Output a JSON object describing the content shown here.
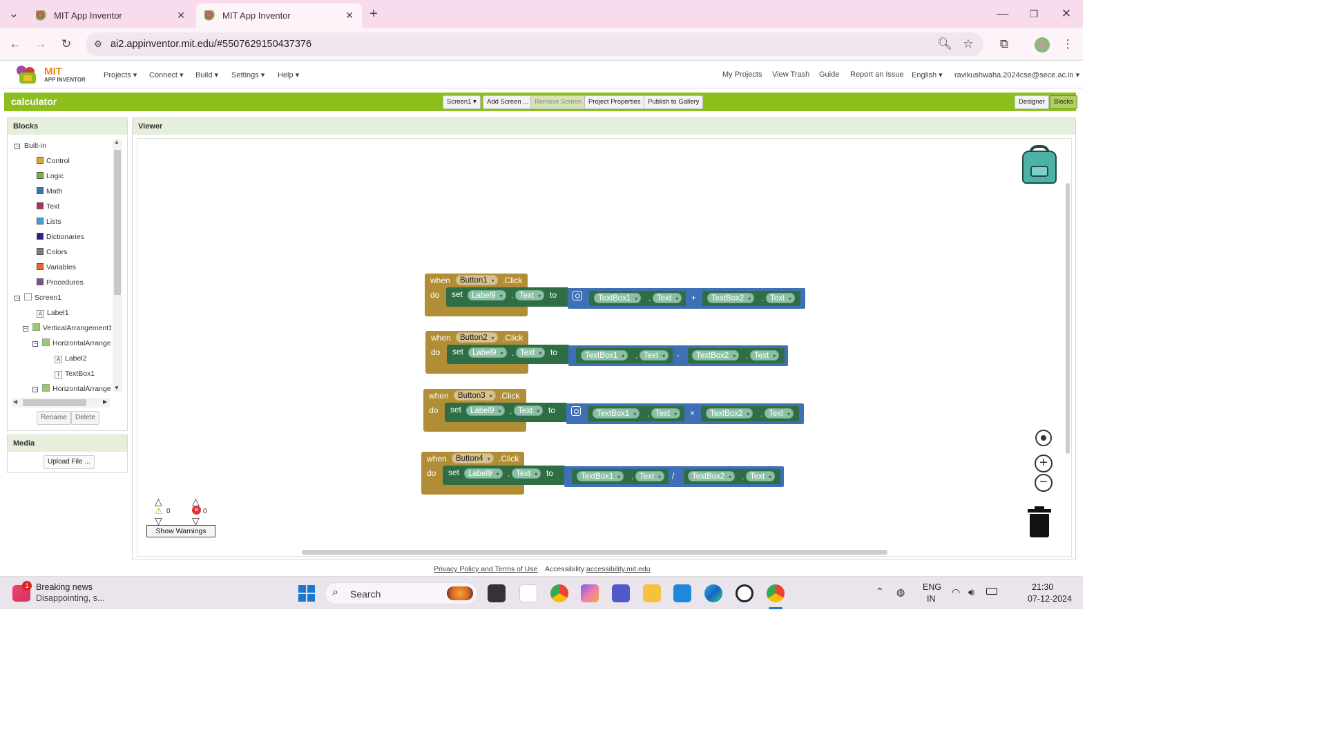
{
  "browser": {
    "tabs": [
      {
        "title": "MIT App Inventor"
      },
      {
        "title": "MIT App Inventor"
      }
    ],
    "url": "ai2.appinventor.mit.edu/#5507629150437376"
  },
  "app": {
    "logo_main": "MIT",
    "logo_sub": "APP INVENTOR",
    "menus": [
      "Projects",
      "Connect",
      "Build",
      "Settings",
      "Help"
    ],
    "right_links": [
      "My Projects",
      "View Trash",
      "Guide",
      "Report an Issue",
      "English"
    ],
    "user": "ravikushwaha.2024cse@sece.ac.in"
  },
  "project": {
    "name": "calculator",
    "screen_select": "Screen1",
    "buttons": [
      "Add Screen ...",
      "Remove Screen",
      "Project Properties",
      "Publish to Gallery"
    ],
    "view_buttons": [
      "Designer",
      "Blocks"
    ]
  },
  "blocks_panel": {
    "title": "Blocks",
    "builtin_label": "Built-in",
    "builtin": [
      {
        "label": "Control",
        "color": "#d9a934"
      },
      {
        "label": "Logic",
        "color": "#77b040"
      },
      {
        "label": "Math",
        "color": "#3f71b5"
      },
      {
        "label": "Text",
        "color": "#b32d5e"
      },
      {
        "label": "Lists",
        "color": "#3fa3d8"
      },
      {
        "label": "Dictionaries",
        "color": "#2d1f91"
      },
      {
        "label": "Colors",
        "color": "#7d7d7d"
      },
      {
        "label": "Variables",
        "color": "#e06c2f"
      },
      {
        "label": "Procedures",
        "color": "#7e4f91"
      }
    ],
    "components": [
      "Screen1",
      "Label1",
      "VerticalArrangement1",
      "HorizontalArrangement",
      "Label2",
      "TextBox1",
      "HorizontalArrangement"
    ],
    "rename": "Rename",
    "delete": "Delete"
  },
  "media_panel": {
    "title": "Media",
    "upload": "Upload File ..."
  },
  "viewer": {
    "title": "Viewer",
    "warnings_count": "0",
    "errors_count": "0",
    "show_warnings": "Show Warnings",
    "blocks": [
      {
        "when": "when",
        "button": "Button1",
        "event": ".Click",
        "do": "do",
        "set": "set",
        "label": "Label9",
        "prop": "Text",
        "to": "to",
        "tb1": "TextBox1",
        "tb2": "TextBox2",
        "text": "Text",
        "op": "+"
      },
      {
        "when": "when",
        "button": "Button2",
        "event": ".Click",
        "do": "do",
        "set": "set",
        "label": "Label9",
        "prop": "Text",
        "to": "to",
        "tb1": "TextBox1",
        "tb2": "TextBox2",
        "text": "Text",
        "op": "-"
      },
      {
        "when": "when",
        "button": "Button3",
        "event": ".Click",
        "do": "do",
        "set": "set",
        "label": "Label9",
        "prop": "Text",
        "to": "to",
        "tb1": "TextBox1",
        "tb2": "TextBox2",
        "text": "Text",
        "op": "×"
      },
      {
        "when": "when",
        "button": "Button4",
        "event": ".Click",
        "do": "do",
        "set": "set",
        "label": "Label9",
        "prop": "Text",
        "to": "to",
        "tb1": "TextBox1",
        "tb2": "TextBox2",
        "text": "Text",
        "op": "/"
      }
    ]
  },
  "footer": {
    "privacy": "Privacy Policy and Terms of Use",
    "access_label": "Accessibility:",
    "access_link": "accessibility.mit.edu"
  },
  "taskbar": {
    "news_title": "Breaking news",
    "news_sub": "Disappointing, s...",
    "news_badge": "1",
    "search": "Search",
    "lang1": "ENG",
    "lang2": "IN",
    "time": "21:30",
    "date": "07-12-2024"
  }
}
